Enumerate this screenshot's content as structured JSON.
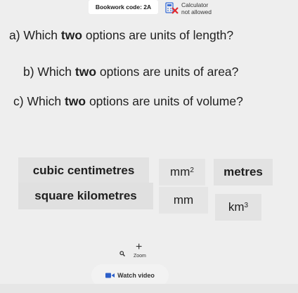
{
  "header": {
    "bookwork_code": "Bookwork code: 2A",
    "calculator_line1": "Calculator",
    "calculator_line2": "not allowed"
  },
  "questions": {
    "a_prefix": "a) Which ",
    "a_bold": "two",
    "a_suffix": " options are units of length?",
    "b_prefix": "b) Which ",
    "b_bold": "two",
    "b_suffix": " options are units of area?",
    "c_prefix": "c) Which ",
    "c_bold": "two",
    "c_suffix": " options are units of volume?"
  },
  "options": {
    "cubic_centimetres": "cubic centimetres",
    "mm2_base": "mm",
    "mm2_exp": "2",
    "metres": "metres",
    "square_kilometres": "square kilometres",
    "mm": "mm",
    "km3_base": "km",
    "km3_exp": "3"
  },
  "controls": {
    "zoom_label": "Zoom",
    "zoom_plus": "+",
    "watch_video_label": "Watch video"
  },
  "icons": {
    "calculator": "calculator-crossed-icon",
    "search": "magnifier-icon",
    "video": "video-camera-icon"
  },
  "colors": {
    "background": "#eeeeee",
    "tile": "#e3e3e3",
    "cross": "#e0282e",
    "calc_icon": "#3a6fd8"
  }
}
